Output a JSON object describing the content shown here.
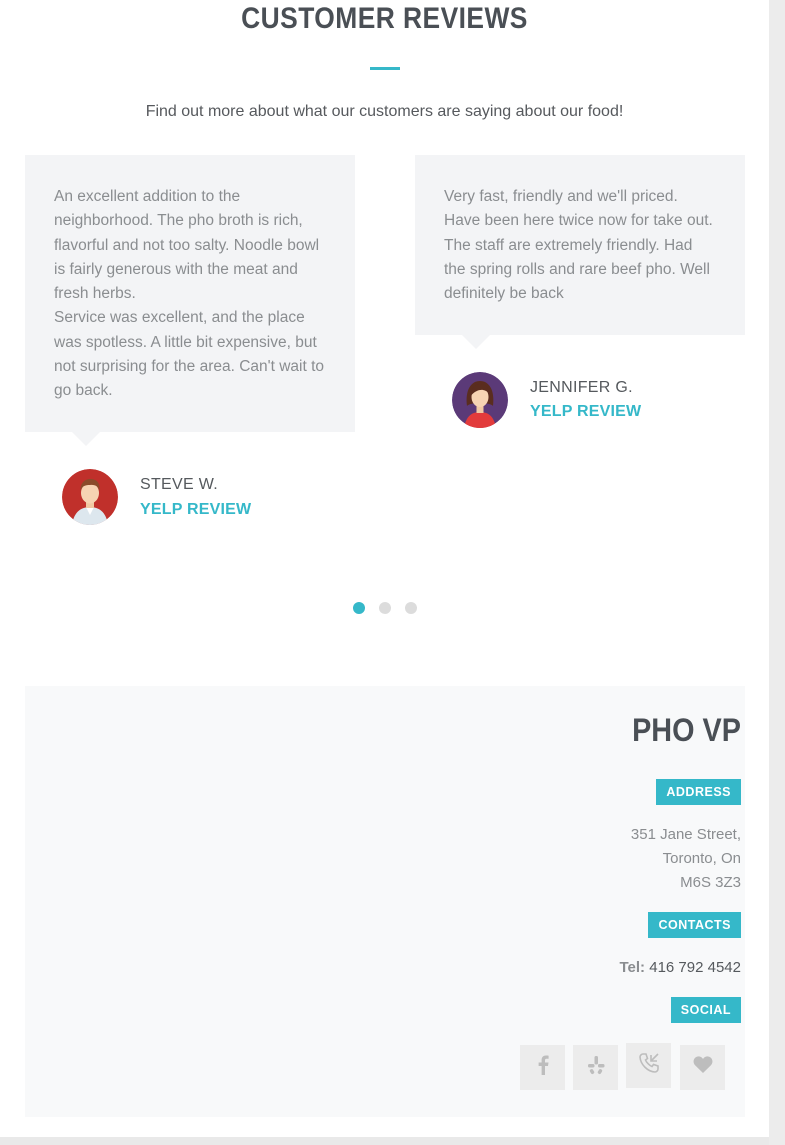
{
  "reviews_section": {
    "title": "CUSTOMER REVIEWS",
    "subtitle": "Find out more about what our customers are saying about our food!"
  },
  "reviews": [
    {
      "paragraphs": [
        "An excellent addition to the neighborhood. The pho broth is rich, flavorful and not too salty. Noodle bowl is fairly generous with the meat and fresh herbs.",
        "Service was excellent, and the place was spotless. A little bit expensive, but not surprising for the area. Can't wait to go back."
      ],
      "name": "STEVE W.",
      "source": "YELP REVIEW",
      "avatar_icon": "male-avatar-icon"
    },
    {
      "paragraphs": [
        "Very fast, friendly and we'll priced. Have been here twice now for take out. The staff are extremely friendly. Had the spring rolls and rare beef pho. Well definitely be back"
      ],
      "name": "JENNIFER G.",
      "source": "YELP REVIEW",
      "avatar_icon": "female-avatar-icon"
    }
  ],
  "pagination": {
    "count": 3,
    "active": 1
  },
  "business": {
    "name": "PHO VP",
    "address_label": "ADDRESS",
    "address_lines": [
      "351 Jane Street,",
      "Toronto, On",
      "M6S 3Z3"
    ],
    "contacts_label": "CONTACTS",
    "tel_label": "Tel:",
    "tel_value": "416 792 4542",
    "social_label": "SOCIAL",
    "social_icons": [
      "facebook-icon",
      "yelp-icon",
      "phone-call-icon",
      "heart-icon"
    ]
  },
  "colors": {
    "accent": "#35b8c9",
    "heading": "#4a4f55",
    "card_bg": "#f3f4f6",
    "panel_bg": "#f8f9fa"
  }
}
